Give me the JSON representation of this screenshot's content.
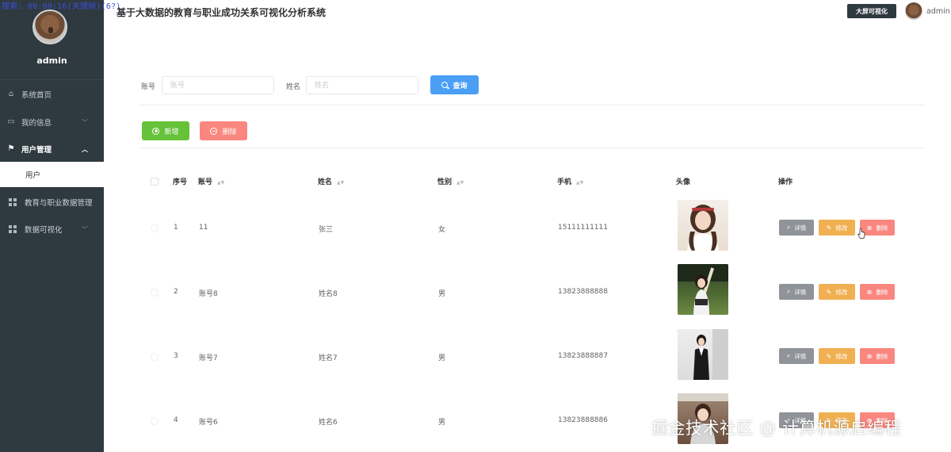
{
  "overlay_text": "搜索: 00:00:16(关键帧)(6?)",
  "sidebar": {
    "username": "admin",
    "items": [
      {
        "label": "系统首页",
        "icon": "home-icon"
      },
      {
        "label": "我的信息",
        "icon": "profile-icon"
      },
      {
        "label": "用户管理",
        "icon": "flag-icon"
      },
      {
        "label": "教育与职业数据管理",
        "icon": "grid-icon"
      },
      {
        "label": "数据可视化",
        "icon": "grid-icon"
      }
    ],
    "submenu_user": "用户"
  },
  "header": {
    "title": "基于大数据的教育与职业成功关系可视化分析系统",
    "screen_button": "大屏可视化",
    "user": "admin"
  },
  "search": {
    "account_label": "账号",
    "account_placeholder": "账号",
    "name_label": "姓名",
    "name_placeholder": "姓名",
    "query_button": "查询"
  },
  "actions": {
    "add_button": "新增",
    "delete_button": "删除"
  },
  "table": {
    "headers": [
      "序号",
      "账号",
      "姓名",
      "性别",
      "手机",
      "头像",
      "操作"
    ],
    "rows": [
      {
        "index": "1",
        "account": "11",
        "name": "张三",
        "gender": "女",
        "phone": "15111111111"
      },
      {
        "index": "2",
        "account": "账号8",
        "name": "姓名8",
        "gender": "男",
        "phone": "13823888888"
      },
      {
        "index": "3",
        "account": "账号7",
        "name": "姓名7",
        "gender": "男",
        "phone": "13823888887"
      },
      {
        "index": "4",
        "account": "账号6",
        "name": "姓名6",
        "gender": "男",
        "phone": "13823888886"
      }
    ],
    "row_actions": {
      "detail": "详情",
      "edit": "修改",
      "delete": "删除"
    }
  },
  "watermark": "掘金技术社区 @ 计算机源启编程",
  "colors": {
    "sidebar": "#2f3a40",
    "primary": "#4a9ff5",
    "success": "#67c23a",
    "danger": "#f9877f",
    "warning": "#f0b052",
    "info": "#909399"
  }
}
